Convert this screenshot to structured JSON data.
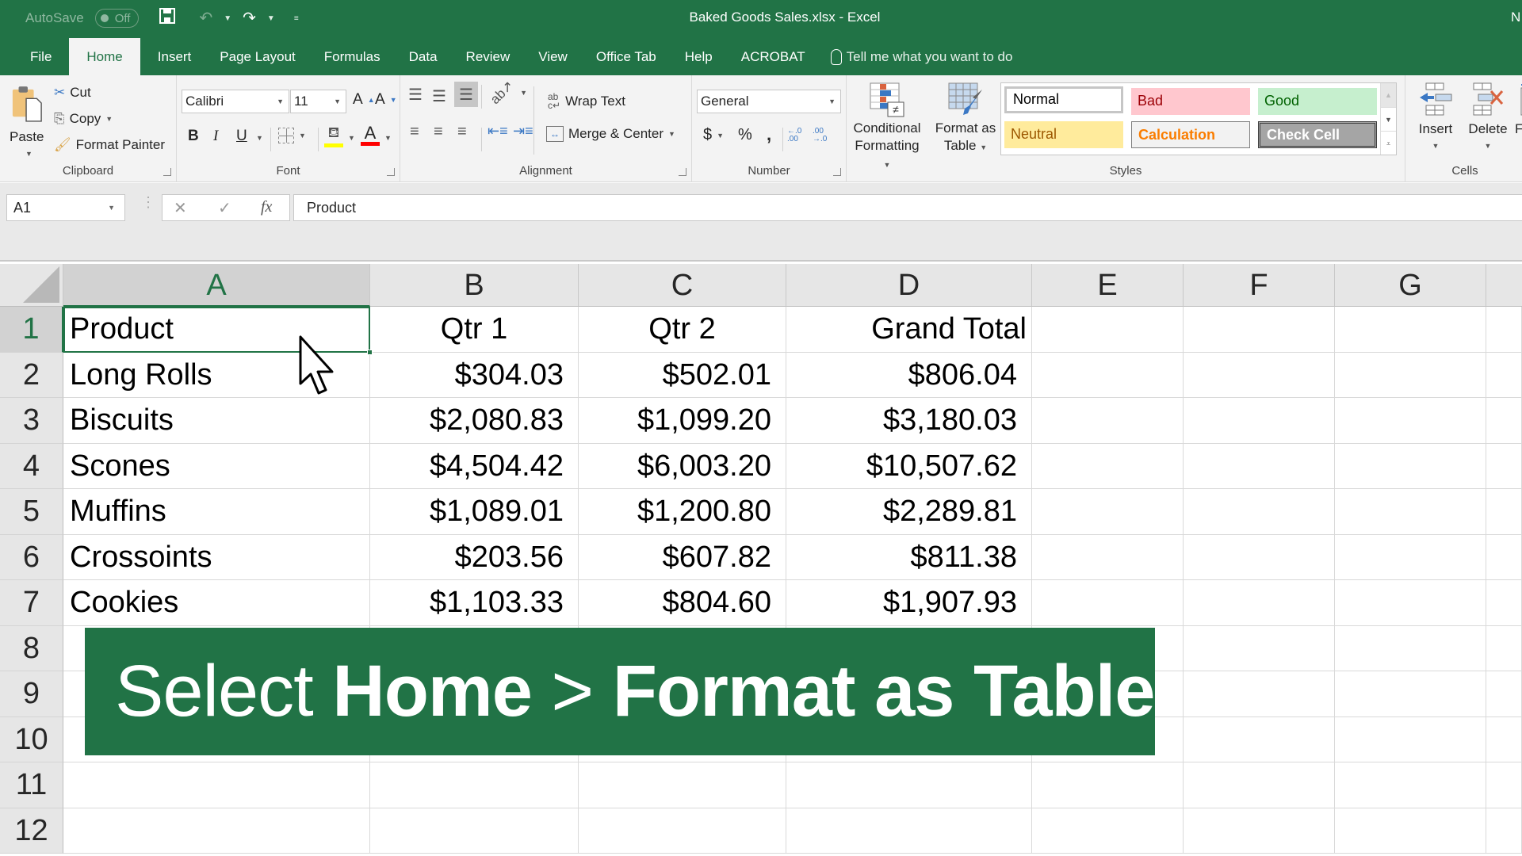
{
  "titlebar": {
    "autosave_label": "AutoSave",
    "autosave_state": "Off",
    "document_title": "Baked Goods Sales.xlsx  -  Excel",
    "user_initial": "N"
  },
  "tabs": [
    "File",
    "Home",
    "Insert",
    "Page Layout",
    "Formulas",
    "Data",
    "Review",
    "View",
    "Office Tab",
    "Help",
    "ACROBAT"
  ],
  "active_tab": "Home",
  "tell_me": "Tell me what you want to do",
  "ribbon": {
    "clipboard": {
      "label": "Clipboard",
      "paste": "Paste",
      "cut": "Cut",
      "copy": "Copy",
      "format_painter": "Format Painter"
    },
    "font": {
      "label": "Font",
      "font_name": "Calibri",
      "font_size": "11",
      "bold": "B",
      "italic": "I",
      "underline": "U",
      "grow": "A",
      "shrink": "A",
      "font_color_letter": "A",
      "highlight_color": "#ffff00",
      "font_color": "#ff0000"
    },
    "alignment": {
      "label": "Alignment",
      "wrap_text": "Wrap Text",
      "merge_center": "Merge & Center"
    },
    "number": {
      "label": "Number",
      "format": "General",
      "currency": "$",
      "percent": "%",
      "comma": ",",
      "increase_decimal": "←.0 .00",
      "decrease_decimal": ".00 →.0"
    },
    "styles": {
      "label": "Styles",
      "conditional_formatting": [
        "Conditional",
        "Formatting"
      ],
      "format_as_table": [
        "Format as",
        "Table"
      ],
      "cells": [
        {
          "name": "Normal",
          "bg": "#ffffff",
          "fg": "#000000"
        },
        {
          "name": "Bad",
          "bg": "#ffc7ce",
          "fg": "#9c0006"
        },
        {
          "name": "Good",
          "bg": "#c6efce",
          "fg": "#006100"
        },
        {
          "name": "Neutral",
          "bg": "#ffeb9c",
          "fg": "#9c5700"
        },
        {
          "name": "Calculation",
          "bg": "#f2f2f2",
          "fg": "#fa7d00"
        },
        {
          "name": "Check Cell",
          "bg": "#a5a5a5",
          "fg": "#ffffff"
        }
      ]
    },
    "cells": {
      "label": "Cells",
      "insert": "Insert",
      "delete": "Delete",
      "format": "Fo"
    }
  },
  "formula_bar": {
    "name_box": "A1",
    "cancel": "✕",
    "enter": "✓",
    "fx": "fx",
    "value": "Product"
  },
  "sheet": {
    "columns": [
      "A",
      "B",
      "C",
      "D",
      "E",
      "F",
      "G"
    ],
    "selected_column": "A",
    "selected_row": 1,
    "row_numbers": [
      "1",
      "2",
      "3",
      "4",
      "5",
      "6",
      "7",
      "8",
      "9",
      "10",
      "11",
      "12"
    ],
    "header": [
      "Product",
      "Qtr 1",
      "Qtr 2",
      "Grand Total"
    ],
    "rows": [
      [
        "Long Rolls",
        "$304.03",
        "$502.01",
        "$806.04"
      ],
      [
        "Biscuits",
        "$2,080.83",
        "$1,099.20",
        "$3,180.03"
      ],
      [
        "Scones",
        "$4,504.42",
        "$6,003.20",
        "$10,507.62"
      ],
      [
        "Muffins",
        "$1,089.01",
        "$1,200.80",
        "$2,289.81"
      ],
      [
        "Crossoints",
        "$203.56",
        "$607.82",
        "$811.38"
      ],
      [
        "Cookies",
        "$1,103.33",
        "$804.60",
        "$1,907.93"
      ]
    ]
  },
  "banner": {
    "prefix": "Select ",
    "bold_1": "Home",
    "separator": " > ",
    "bold_2": "Format as Table",
    "background": "#217346"
  }
}
